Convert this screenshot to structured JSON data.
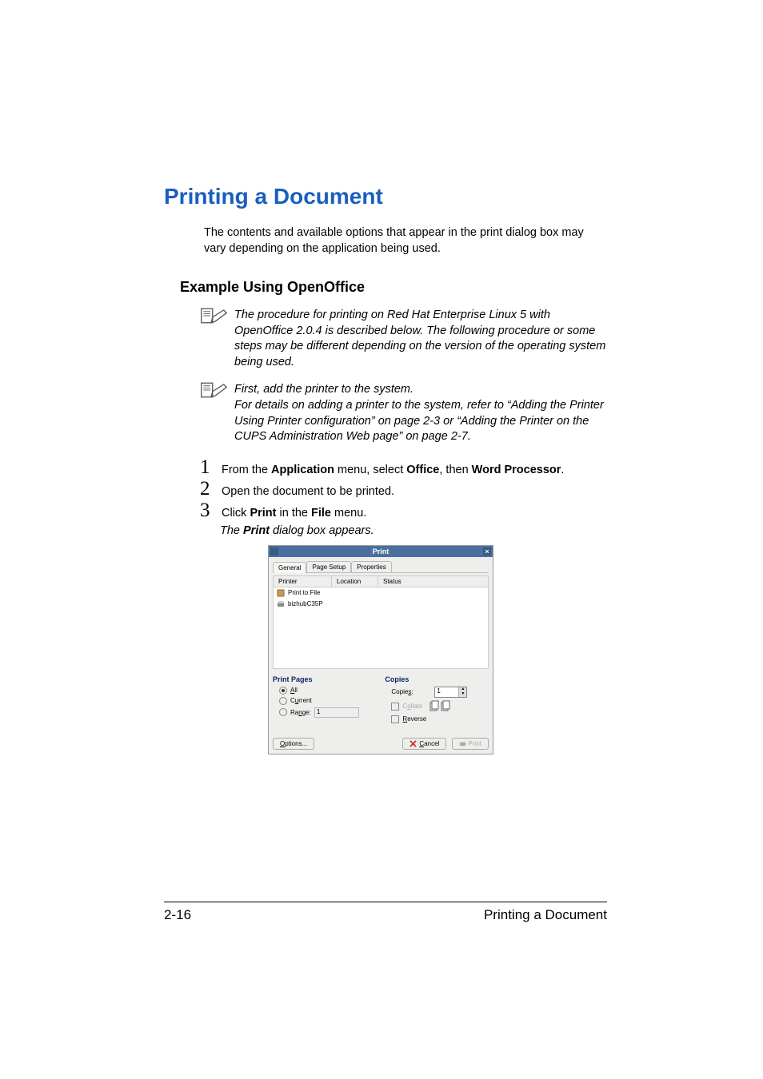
{
  "title": "Printing a Document",
  "intro": "The contents and available options that appear in the print dialog box may vary depending on the application being used.",
  "section_title": "Example Using OpenOffice",
  "note1": "The procedure for printing on Red Hat Enterprise Linux 5 with OpenOffice 2.0.4 is described below. The following procedure or some steps may be different depending on the version of the operating system being used.",
  "note2_line1": "First, add the printer to the system.",
  "note2_line2": "For details on adding a printer to the system, refer to “Adding the Printer Using Printer configuration” on page 2-3 or “Adding the Printer on the CUPS Administration Web page” on page 2-7.",
  "steps": {
    "s1_pre": "From the ",
    "s1_b1": "Application",
    "s1_mid1": " menu, select ",
    "s1_b2": "Office",
    "s1_mid2": ", then ",
    "s1_b3": "Word Processor",
    "s1_end": ".",
    "s2": "Open the document to be printed.",
    "s3_pre": "Click ",
    "s3_b1": "Print",
    "s3_mid": " in the ",
    "s3_b2": "File",
    "s3_end": " menu."
  },
  "sub_pre": "The ",
  "sub_b": "Print",
  "sub_end": " dialog box appears.",
  "dialog": {
    "title": "Print",
    "close": "×",
    "tabs": {
      "t1": "General",
      "t2": "Page Setup",
      "t3": "Properties"
    },
    "header": {
      "c1": "Printer",
      "c2": "Location",
      "c3": "Status"
    },
    "printers": {
      "p1": "Print to File",
      "p2": "bizhubC35P"
    },
    "pages_hdr": "Print Pages",
    "opt_all_u": "A",
    "opt_all_rest": "ll",
    "opt_cur_pre": "C",
    "opt_cur_u": "u",
    "opt_cur_rest": "rrent",
    "opt_range_pre": "Ra",
    "opt_range_u": "n",
    "opt_range_rest": "ge:",
    "range_value": "1",
    "copies_hdr": "Copies",
    "copies_pre": "Copie",
    "copies_u": "s",
    "copies_end": ":",
    "copies_value": "1",
    "collate_pre": "C",
    "collate_u": "o",
    "collate_rest": "llate",
    "reverse_u": "R",
    "reverse_rest": "everse",
    "options_u": "O",
    "options_rest": "ptions...",
    "cancel_u": "C",
    "cancel_rest": "ancel",
    "print_btn": "Print"
  },
  "footer": {
    "page": "2-16",
    "label": "Printing a Document"
  }
}
